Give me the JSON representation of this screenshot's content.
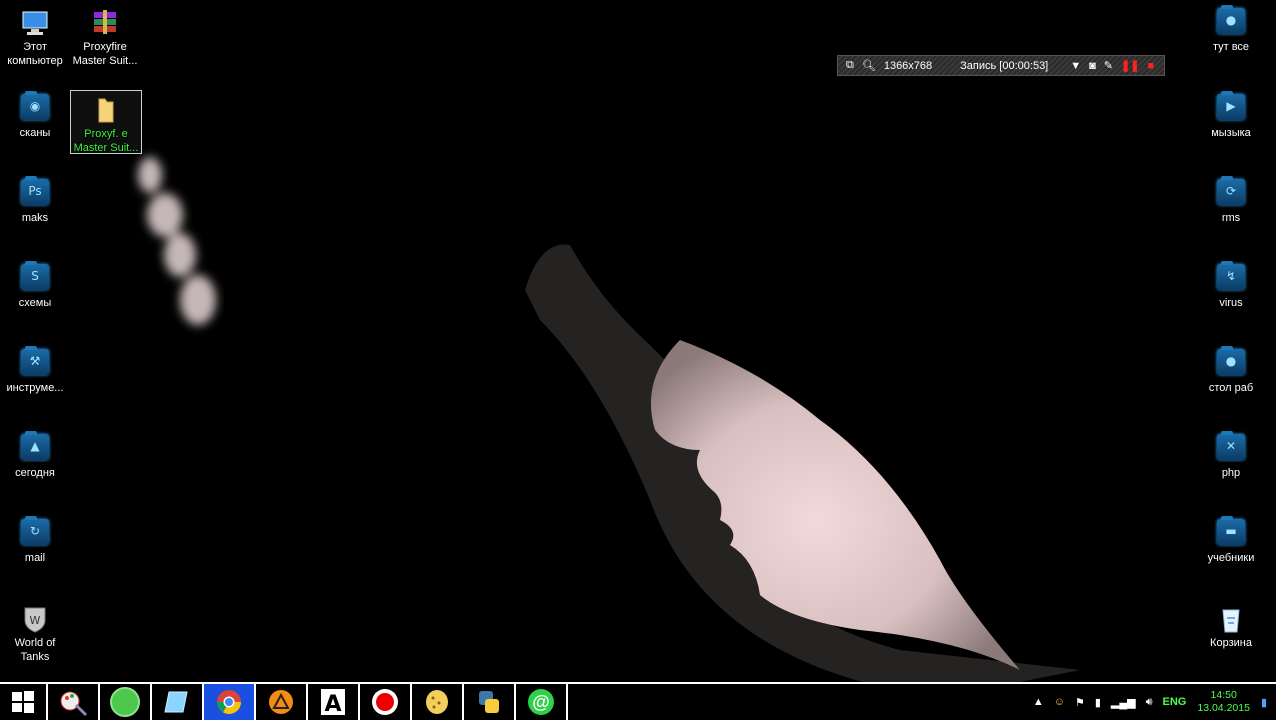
{
  "desktop": {
    "left_icons": [
      {
        "label": "Этот\nкомпьютер",
        "icon": "computer-icon"
      },
      {
        "label": "сканы",
        "icon": "folder-tile-icon"
      },
      {
        "label": "maks",
        "icon": "folder-tile-icon"
      },
      {
        "label": "схемы",
        "icon": "folder-tile-icon"
      },
      {
        "label": "инструме...",
        "icon": "folder-tile-icon"
      },
      {
        "label": "сегодня",
        "icon": "folder-tile-icon"
      },
      {
        "label": "mail",
        "icon": "folder-tile-icon"
      },
      {
        "label": "World of\nTanks",
        "icon": "world-of-tanks-icon"
      }
    ],
    "second_column_icons": [
      {
        "label": "Proxyfire\nMaster Suit...",
        "icon": "winrar-archive-icon"
      },
      {
        "label": "Proxyf. e\nMaster Suit...",
        "icon": "folder-icon",
        "selected": true
      }
    ],
    "right_icons": [
      {
        "label": "тут все",
        "icon": "folder-tile-icon"
      },
      {
        "label": "мызыка",
        "icon": "folder-tile-icon"
      },
      {
        "label": "rms",
        "icon": "folder-tile-icon"
      },
      {
        "label": "virus",
        "icon": "folder-tile-icon"
      },
      {
        "label": "стол раб",
        "icon": "folder-tile-icon"
      },
      {
        "label": "php",
        "icon": "folder-tile-icon"
      },
      {
        "label": "учебники",
        "icon": "folder-tile-icon"
      },
      {
        "label": "Корзина",
        "icon": "recycle-bin-icon"
      }
    ]
  },
  "recorder": {
    "resolution": "1366x768",
    "recording": "Запись [00:00:53]"
  },
  "taskbar": {
    "apps": [
      {
        "name": "start-button",
        "icon": "windows-logo-icon"
      },
      {
        "name": "paint-app",
        "icon": "paint-icon"
      },
      {
        "name": "utorrent-app",
        "icon": "utorrent-icon"
      },
      {
        "name": "notes-app",
        "icon": "notes-icon"
      },
      {
        "name": "chrome-app",
        "icon": "chrome-icon",
        "active": true
      },
      {
        "name": "aimp-app",
        "icon": "aimp-icon"
      },
      {
        "name": "font-app",
        "icon": "font-icon"
      },
      {
        "name": "recorder-app",
        "icon": "record-icon"
      },
      {
        "name": "cookie-app",
        "icon": "cookie-icon"
      },
      {
        "name": "python-app",
        "icon": "python-icon"
      },
      {
        "name": "mail-agent-app",
        "icon": "mail-agent-icon"
      }
    ],
    "tray": {
      "language": "ENG",
      "time": "14:50",
      "date": "13.04.2015"
    }
  },
  "colors": {
    "taskbar_active": "#1a4fe0",
    "tile_blue": "#1b6ca8",
    "selected_label": "#3ef23e",
    "tray_green": "#4cff4c"
  }
}
